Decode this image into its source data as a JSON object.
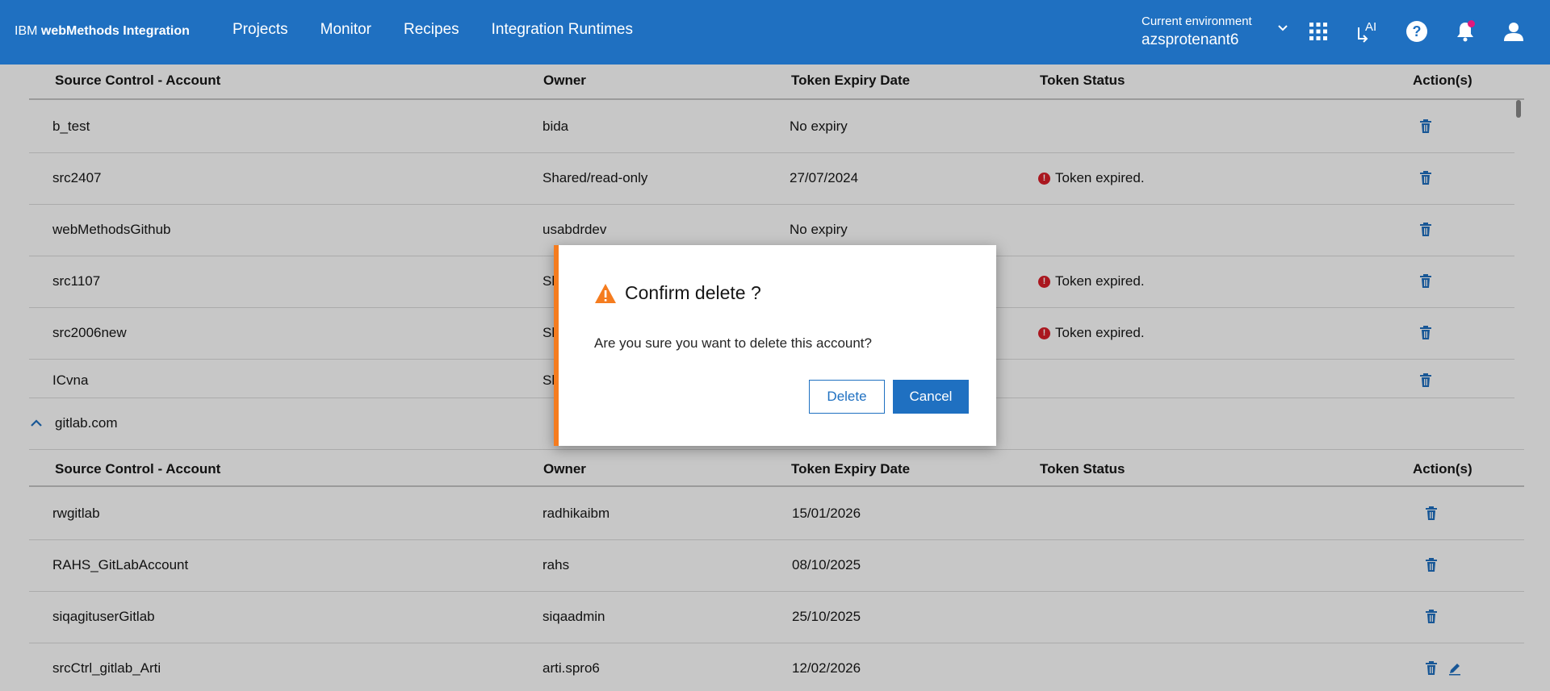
{
  "header": {
    "brand_prefix": "IBM",
    "brand_name": "webMethods Integration",
    "nav": [
      "Projects",
      "Monitor",
      "Recipes",
      "Integration Runtimes"
    ],
    "env_label": "Current environment",
    "env_value": "azsprotenant6",
    "ai_label": "AI"
  },
  "columns": [
    "Source Control - Account",
    "Owner",
    "Token Expiry Date",
    "Token Status",
    "Action(s)"
  ],
  "github_rows": [
    {
      "account": "b_test",
      "owner": "bida",
      "expiry": "No expiry",
      "status": ""
    },
    {
      "account": "src2407",
      "owner": "Shared/read-only",
      "expiry": "27/07/2024",
      "status": "Token expired."
    },
    {
      "account": "webMethodsGithub",
      "owner": "usabdrdev",
      "expiry": "No expiry",
      "status": ""
    },
    {
      "account": "src1107",
      "owner": "Sh",
      "expiry": "",
      "status": "Token expired."
    },
    {
      "account": "src2006new",
      "owner": "Sh",
      "expiry": "",
      "status": "Token expired."
    },
    {
      "account": "ICvna",
      "owner": "Sh",
      "expiry": "",
      "status": ""
    }
  ],
  "gitlab_group": "gitlab.com",
  "gitlab_rows": [
    {
      "account": "rwgitlab",
      "owner": "radhikaibm",
      "expiry": "15/01/2026",
      "status": ""
    },
    {
      "account": "RAHS_GitLabAccount",
      "owner": "rahs",
      "expiry": "08/10/2025",
      "status": ""
    },
    {
      "account": "siqagituserGitlab",
      "owner": "siqaadmin",
      "expiry": "25/10/2025",
      "status": ""
    },
    {
      "account": "srcCtrl_gitlab_Arti",
      "owner": "arti.spro6",
      "expiry": "12/02/2026",
      "status": ""
    }
  ],
  "modal": {
    "title": "Confirm delete ?",
    "message": "Are you sure you want to delete this account?",
    "delete_label": "Delete",
    "cancel_label": "Cancel"
  },
  "colors": {
    "brand_blue": "#1f70c1",
    "warning_orange": "#f57c1f",
    "error_red": "#da1e28"
  },
  "icons": [
    "grid-icon",
    "ai-icon",
    "help-icon",
    "bell-icon",
    "user-icon",
    "trash-icon",
    "edit-icon",
    "warning-icon",
    "error-icon",
    "chevron-up-icon",
    "chevron-down-icon"
  ]
}
